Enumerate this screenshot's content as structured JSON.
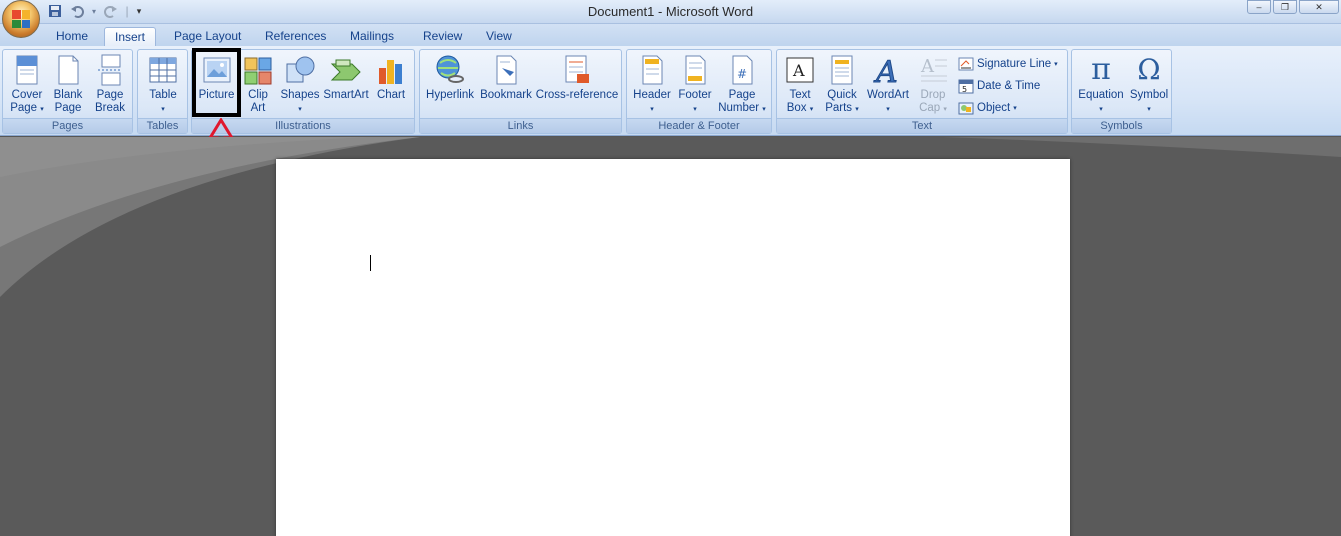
{
  "window": {
    "title": "Document1 - Microsoft Word",
    "controls": [
      "–",
      "❐",
      "✕"
    ]
  },
  "quick_access": {
    "separator": "|",
    "more": "▾"
  },
  "tabs": [
    {
      "label": "Home",
      "active": false
    },
    {
      "label": "Insert",
      "active": true
    },
    {
      "label": "Page Layout",
      "active": false
    },
    {
      "label": "References",
      "active": false
    },
    {
      "label": "Mailings",
      "active": false
    },
    {
      "label": "Review",
      "active": false
    },
    {
      "label": "View",
      "active": false
    }
  ],
  "groups": {
    "pages": {
      "label": "Pages",
      "cover_page": {
        "line1": "Cover",
        "line2": "Page"
      },
      "blank_page": {
        "line1": "Blank",
        "line2": "Page"
      },
      "page_break": {
        "line1": "Page",
        "line2": "Break"
      }
    },
    "tables": {
      "label": "Tables",
      "table": "Table"
    },
    "illustrations": {
      "label": "Illustrations",
      "picture": "Picture",
      "clip_art": {
        "line1": "Clip",
        "line2": "Art"
      },
      "shapes": "Shapes",
      "smartart": "SmartArt",
      "chart": "Chart"
    },
    "links": {
      "label": "Links",
      "hyperlink": "Hyperlink",
      "bookmark": "Bookmark",
      "cross_reference": "Cross-reference"
    },
    "header_footer": {
      "label": "Header & Footer",
      "header": "Header",
      "footer": "Footer",
      "page_number": {
        "line1": "Page",
        "line2": "Number"
      }
    },
    "text": {
      "label": "Text",
      "text_box": {
        "line1": "Text",
        "line2": "Box"
      },
      "quick_parts": {
        "line1": "Quick",
        "line2": "Parts"
      },
      "wordart": "WordArt",
      "drop_cap": {
        "line1": "Drop",
        "line2": "Cap"
      },
      "signature_line": "Signature Line",
      "date_time": "Date & Time",
      "object": "Object"
    },
    "symbols": {
      "label": "Symbols",
      "equation": "Equation",
      "symbol": "Symbol",
      "pi": "π",
      "omega": "Ω"
    }
  },
  "dropdown_marker": "▾",
  "colors": {
    "ribbon_text": "#15428b",
    "highlight": "#000000",
    "arrow": "#e0182e",
    "workspace": "#5a5a5a"
  }
}
